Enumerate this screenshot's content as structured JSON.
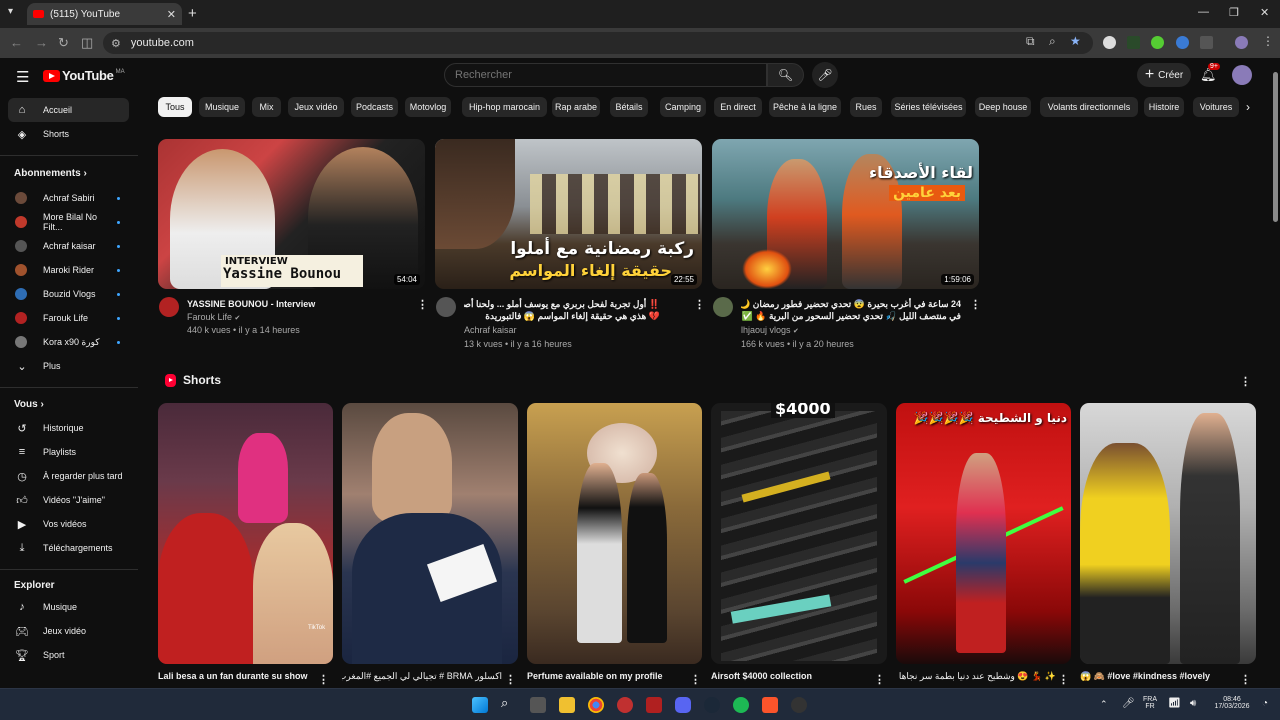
{
  "browser": {
    "tab_title": "(5115) YouTube",
    "url": "youtube.com",
    "tab_close": "✕",
    "new_tab": "+"
  },
  "header": {
    "logo_text": "YouTube",
    "country_code": "MA",
    "search_placeholder": "Rechercher",
    "create_label": "Créer",
    "notif_count": "9+"
  },
  "sidebar": {
    "main": [
      {
        "label": "Accueil",
        "icon": "home-icon"
      },
      {
        "label": "Shorts",
        "icon": "shorts-icon"
      }
    ],
    "subscriptions_title": "Abonnements",
    "subscriptions": [
      {
        "label": "Achraf Sabiri",
        "color": "#6b4a3a"
      },
      {
        "label": "More Bilal No Filt...",
        "color": "#c0392b"
      },
      {
        "label": "Achraf kaisar",
        "color": "#555555"
      },
      {
        "label": "Maroki Rider",
        "color": "#a0522d"
      },
      {
        "label": "Bouzid Vlogs",
        "color": "#2e6db4"
      },
      {
        "label": "Farouk Life",
        "color": "#b22222"
      },
      {
        "label": "Kora x90 كورة",
        "color": "#777777"
      }
    ],
    "more_label": "Plus",
    "you_title": "Vous",
    "you_items": [
      {
        "label": "Historique"
      },
      {
        "label": "Playlists"
      },
      {
        "label": "À regarder plus tard"
      },
      {
        "label": "Vidéos \"J'aime\""
      },
      {
        "label": "Vos vidéos"
      },
      {
        "label": "Téléchargements"
      }
    ],
    "explore_title": "Explorer",
    "explore_items": [
      {
        "label": "Musique"
      },
      {
        "label": "Jeux vidéo"
      },
      {
        "label": "Sport"
      }
    ]
  },
  "chips": [
    "Tous",
    "Musique",
    "Mix",
    "Jeux vidéo",
    "Podcasts",
    "Motovlog",
    "Hip-hop marocain",
    "Rap arabe",
    "Bétails",
    "Camping",
    "En direct",
    "Pêche à la ligne",
    "Rues",
    "Séries télévisées",
    "Deep house",
    "Volants directionnels",
    "Histoire",
    "Voitures"
  ],
  "videos": [
    {
      "title": "YASSINE BOUNOU - Interview",
      "channel": "Farouk Life",
      "verified": "✔",
      "stats": "440 k vues • il y a 14 heures",
      "duration": "54:04",
      "overlay_top": "INTERVIEW",
      "overlay_main": "Yassine Bounou"
    },
    {
      "title_line1": "‼️ أول تجربة لفحل بربري مع يوسف أملو ... ولحنا أصحاب لحنة",
      "title_line2": "💔 هذي هي حقيقة إلغاء المواسم 😱 فالتبوريدة",
      "channel": "Achraf kaisar",
      "stats": "13 k vues • il y a 16 heures",
      "duration": "22:55",
      "overlay_line1": "ركبة رمضانية مع أملوا",
      "overlay_line2": "حقيقة إلغاء المواسم"
    },
    {
      "title_line1": "24 ساعة في أغرب بحيرة 😨 تحدي تحضير فطور رمضان 🌙 صيد",
      "title_line2": "في منتصف الليل 🎣 تحدي تحضير السحور من البرية 🔥 ✅",
      "channel": "lhjaouj vlogs",
      "verified": "✔",
      "stats": "166 k vues • il y a 20 heures",
      "duration": "1:59:06",
      "overlay_line1": "لقاء الأصدقاء",
      "overlay_line2": "بعد عامين"
    }
  ],
  "shorts": {
    "title": "Shorts",
    "items": [
      {
        "title": "Lali besa a un fan durante su show",
        "watermark": "TikTok"
      },
      {
        "title": "اكسلور BRMA # تجيالي لي الجميع #المغرب"
      },
      {
        "title": "Perfume available on my profile"
      },
      {
        "title": "Airsoft $4000 collection",
        "overlay": "$4000"
      },
      {
        "title": "✨ 💃 😍 وشطيح عند دنيا بطمة سر نجاها",
        "overlay": "دنيا و الشطيحة 🎉🎉🎉🎉"
      },
      {
        "title": "😱 🙈 #love #kindness #lovely"
      }
    ]
  },
  "taskbar": {
    "lang_line1": "FRA",
    "lang_line2": "FR",
    "time": "08:46",
    "date": "17/03/2026"
  }
}
